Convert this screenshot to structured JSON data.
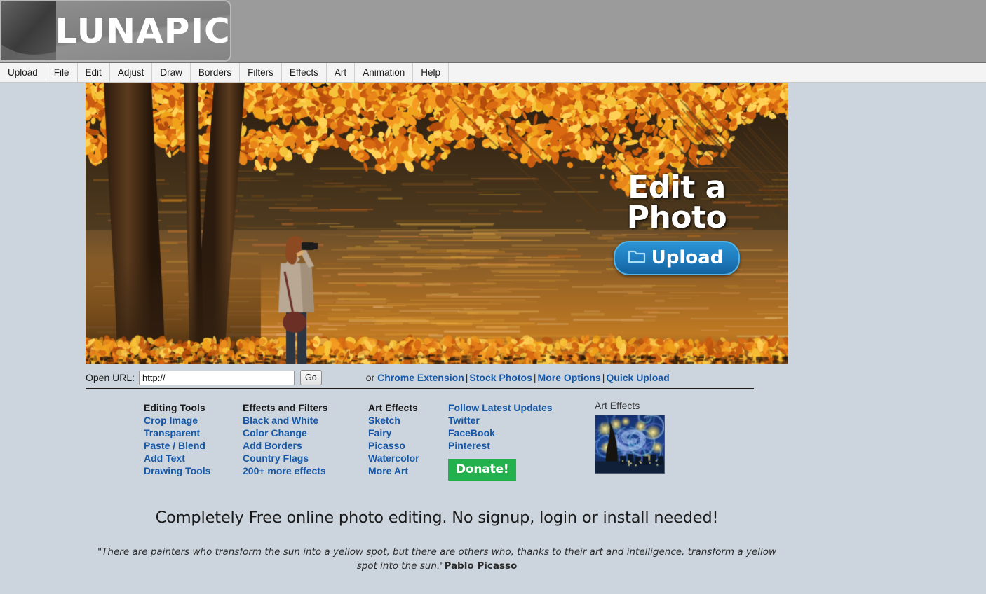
{
  "header": {
    "logo_text": "LUNAPIC",
    "logo_icon": "crescent-moon-icon"
  },
  "menu": {
    "items": [
      {
        "label": "Upload"
      },
      {
        "label": "File"
      },
      {
        "label": "Edit"
      },
      {
        "label": "Adjust"
      },
      {
        "label": "Draw"
      },
      {
        "label": "Borders"
      },
      {
        "label": "Filters"
      },
      {
        "label": "Effects"
      },
      {
        "label": "Art"
      },
      {
        "label": "Animation"
      },
      {
        "label": "Help"
      }
    ]
  },
  "hero": {
    "title_line1": "Edit a",
    "title_line2": "Photo",
    "upload_label": "Upload",
    "upload_icon": "folder-icon",
    "image_alt": "autumn-photographer-by-river"
  },
  "url_bar": {
    "label": "Open URL:",
    "value": "http://",
    "placeholder": "http://",
    "go_label": "Go",
    "prefix": "or",
    "links": [
      {
        "label": "Chrome Extension"
      },
      {
        "label": "Stock Photos"
      },
      {
        "label": "More Options"
      },
      {
        "label": "Quick Upload"
      }
    ],
    "separator": "|"
  },
  "columns": [
    {
      "heading": "Editing Tools",
      "heading_is_link": false,
      "links": [
        "Crop Image",
        "Transparent",
        "Paste / Blend",
        "Add Text",
        "Drawing Tools"
      ]
    },
    {
      "heading": "Effects and Filters",
      "heading_is_link": false,
      "links": [
        "Black and White",
        "Color Change",
        "Add Borders",
        "Country Flags",
        "200+ more effects"
      ]
    },
    {
      "heading": "Art Effects",
      "heading_is_link": false,
      "links": [
        "Sketch",
        "Fairy",
        "Picasso",
        "Watercolor",
        "More Art"
      ]
    },
    {
      "heading": "Follow Latest Updates",
      "heading_is_link": true,
      "links": [
        "Twitter",
        "FaceBook",
        "Pinterest"
      ]
    }
  ],
  "donate": {
    "label": "Donate!"
  },
  "art_thumb": {
    "label": "Art Effects",
    "image_alt": "starry-night-painting"
  },
  "tagline": {
    "text": "Completely Free online photo editing. No signup, login or install needed!"
  },
  "quote": {
    "text": "\"There are painters who transform the sun into a yellow spot, but there are others who, thanks to their art and intelligence, transform a yellow spot into the sun.\"",
    "author": "Pablo Picasso"
  },
  "colors": {
    "page_background": "#ccd5de",
    "header_background": "#9b9b9b",
    "menu_background": "#f4f4f4",
    "link_blue": "#1558a8",
    "upload_blue": "#1f7cbd",
    "donate_green": "#22b14c",
    "text_dark": "#1a1a1a"
  }
}
